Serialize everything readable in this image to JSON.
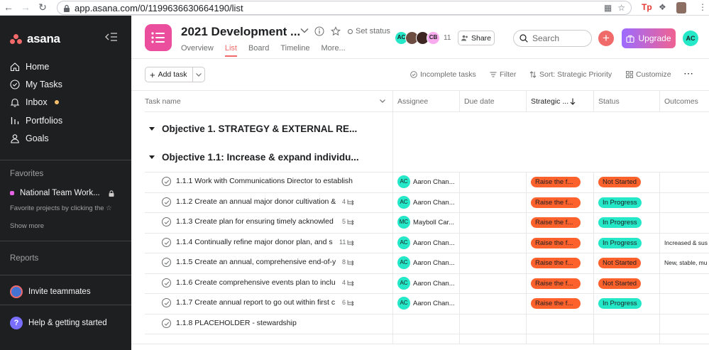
{
  "browser": {
    "url": "app.asana.com/0/1199636630664190/list"
  },
  "sidebar": {
    "logo": "asana",
    "nav": [
      {
        "label": "Home",
        "icon": "home-icon"
      },
      {
        "label": "My Tasks",
        "icon": "check-circle-icon"
      },
      {
        "label": "Inbox",
        "icon": "bell-icon"
      },
      {
        "label": "Portfolios",
        "icon": "bar-chart-icon"
      },
      {
        "label": "Goals",
        "icon": "person-icon"
      }
    ],
    "favorites_label": "Favorites",
    "favorite_project": "National Team Work...",
    "favorites_hint": "Favorite projects by clicking the ☆",
    "show_more": "Show more",
    "reports_label": "Reports",
    "invite": "Invite teammates",
    "help": "Help & getting started"
  },
  "header": {
    "title": "2021 Development ...",
    "set_status": "Set status",
    "tabs": [
      "Overview",
      "List",
      "Board",
      "Timeline",
      "More..."
    ],
    "active_tab": "List",
    "members": [
      {
        "initials": "AC",
        "color": "#25e8c8"
      },
      {
        "initials": "",
        "color": "#6d4c41"
      },
      {
        "initials": "",
        "color": "#3e2723"
      },
      {
        "initials": "CB",
        "color": "#f9aaef"
      }
    ],
    "member_count": "11",
    "share": "Share",
    "search_placeholder": "Search",
    "upgrade": "Upgrade",
    "me_initials": "AC"
  },
  "toolbar": {
    "add_task": "Add task",
    "incomplete": "Incomplete tasks",
    "filter": "Filter",
    "sort": "Sort: Strategic Priority",
    "customize": "Customize"
  },
  "table": {
    "columns": [
      "Task name",
      "Assignee",
      "Due date",
      "Strategic ...",
      "Status",
      "Outcomes"
    ],
    "sections": [
      "Objective 1. STRATEGY & EXTERNAL RE...",
      "Objective 1.1: Increase & expand individu..."
    ],
    "tasks": [
      {
        "name": "1.1.1 Work with Communications Director to establish",
        "subtasks": "",
        "assignee_initials": "AC",
        "assignee": "Aaron Chan...",
        "priority": "Raise the f...",
        "status": "Not Started",
        "outcome": ""
      },
      {
        "name": "1.1.2 Create an annual major donor cultivation &",
        "subtasks": "4",
        "assignee_initials": "AC",
        "assignee": "Aaron Chan...",
        "priority": "Raise the f...",
        "status": "In Progress",
        "outcome": ""
      },
      {
        "name": "1.1.3 Create plan for ensuring timely acknowled",
        "subtasks": "5",
        "assignee_initials": "MC",
        "assignee": "Mayboll Car...",
        "priority": "Raise the f...",
        "status": "In Progress",
        "outcome": ""
      },
      {
        "name": "1.1.4 Continually refine major donor plan, and s",
        "subtasks": "11",
        "assignee_initials": "AC",
        "assignee": "Aaron Chan...",
        "priority": "Raise the f...",
        "status": "In Progress",
        "outcome": "Increased & sus"
      },
      {
        "name": "1.1.5 Create an annual, comprehensive end-of-y",
        "subtasks": "8",
        "assignee_initials": "AC",
        "assignee": "Aaron Chan...",
        "priority": "Raise the f...",
        "status": "Not Started",
        "outcome": "New, stable, mu"
      },
      {
        "name": "1.1.6 Create comprehensive events plan to inclu",
        "subtasks": "4",
        "assignee_initials": "AC",
        "assignee": "Aaron Chan...",
        "priority": "Raise the f...",
        "status": "Not Started",
        "outcome": ""
      },
      {
        "name": "1.1.7 Create annual report to go out within first c",
        "subtasks": "6",
        "assignee_initials": "AC",
        "assignee": "Aaron Chan...",
        "priority": "Raise the f...",
        "status": "In Progress",
        "outcome": ""
      },
      {
        "name": "1.1.8 PLACEHOLDER - stewardship",
        "subtasks": "",
        "assignee_initials": "",
        "assignee": "",
        "priority": "",
        "status": "",
        "outcome": ""
      }
    ]
  },
  "colors": {
    "accent": "#f06a6a",
    "priority_pill": "#fd612c",
    "not_started": "#fd612c",
    "in_progress": "#25e8c8",
    "sidebar_bg": "#1e1f21"
  }
}
